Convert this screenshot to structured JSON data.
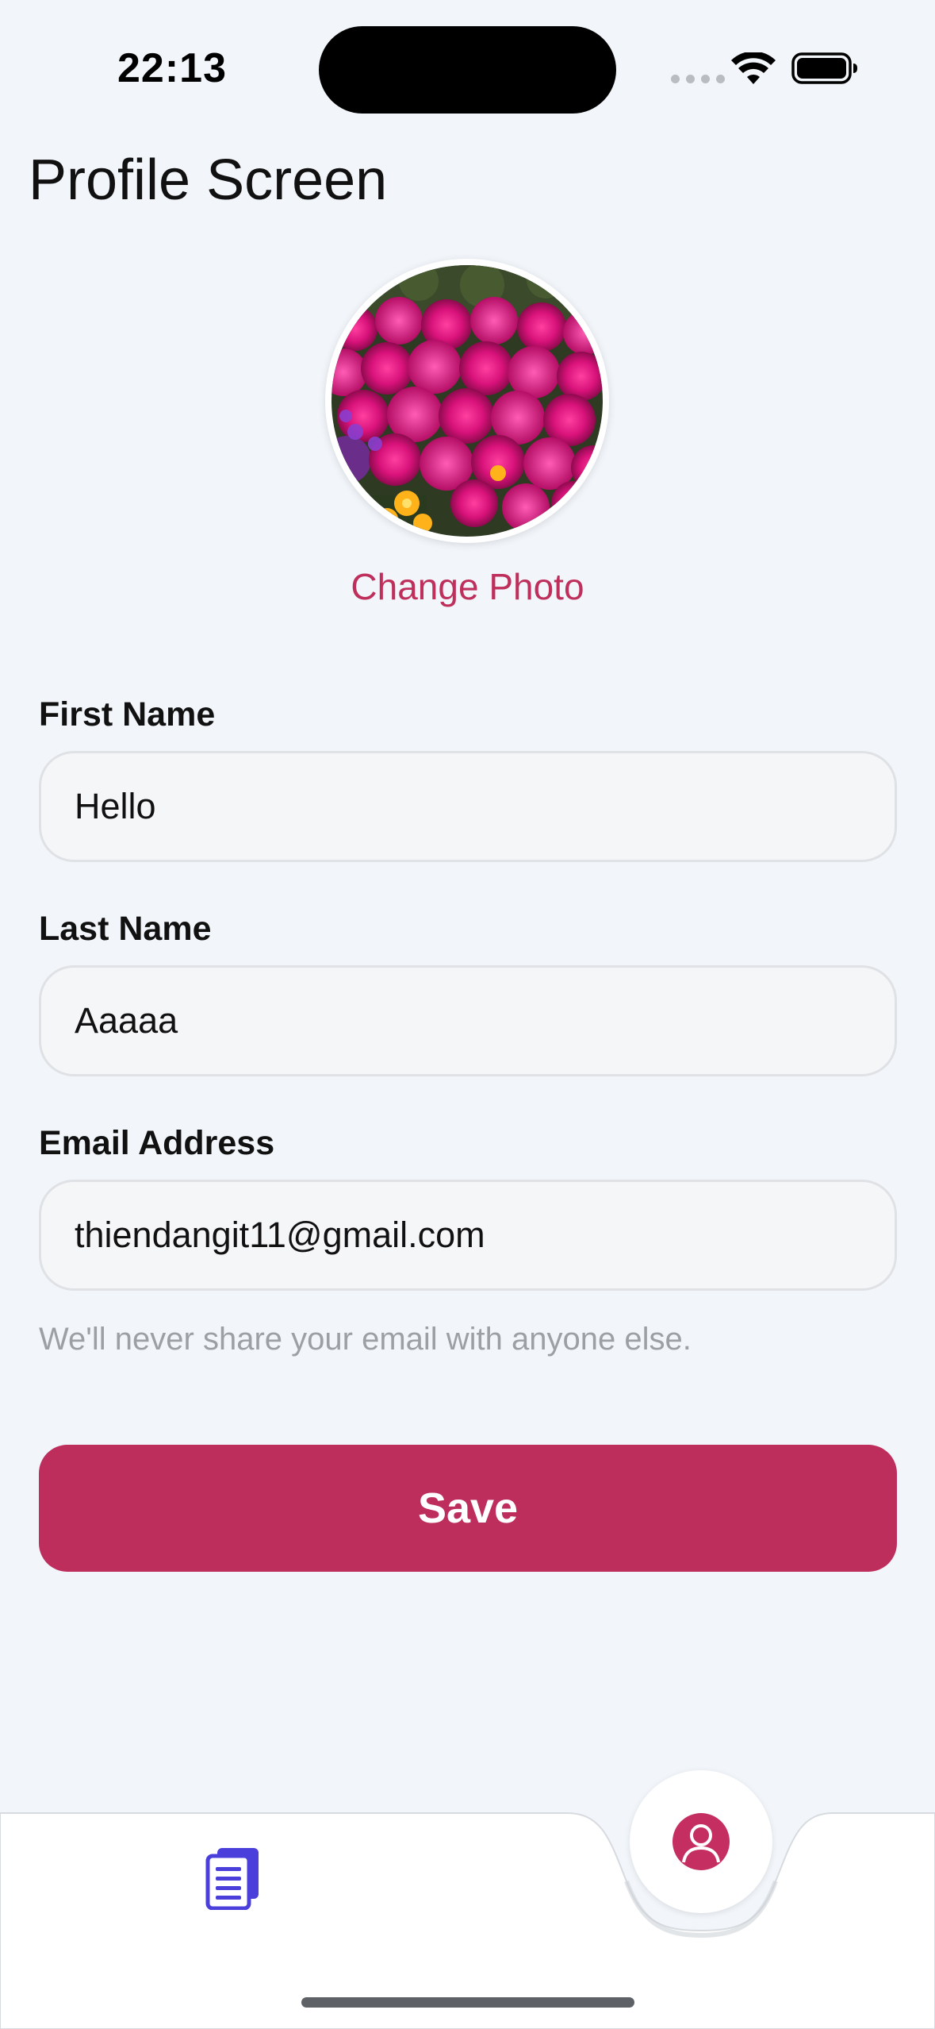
{
  "status_bar": {
    "time": "22:13",
    "icons": [
      "cellular-signal-icon",
      "wifi-icon",
      "battery-icon"
    ]
  },
  "header": {
    "title": "Profile Screen"
  },
  "profile": {
    "avatar_icon": "flower-photo",
    "change_photo_label": "Change Photo"
  },
  "form": {
    "first_name": {
      "label": "First Name",
      "value": "Hello"
    },
    "last_name": {
      "label": "Last Name",
      "value": "Aaaaa"
    },
    "email": {
      "label": "Email Address",
      "value": "thiendangit11@gmail.com",
      "help": "We'll never share your email with anyone else."
    },
    "save_label": "Save"
  },
  "tab_bar": {
    "items": [
      {
        "icon": "document-list-icon",
        "active": false
      },
      {
        "icon": "user-profile-icon",
        "active": true
      }
    ]
  },
  "colors": {
    "accent": "#bd2e5c",
    "background": "#f2f6fa",
    "tab_icon": "#4b3fdc"
  }
}
